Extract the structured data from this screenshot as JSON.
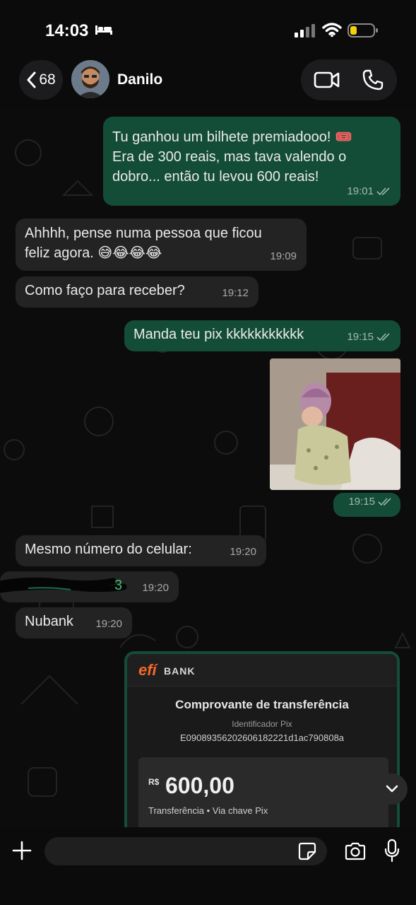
{
  "status_bar": {
    "time": "14:03"
  },
  "header": {
    "back_count": "68",
    "contact_name": "Danilo"
  },
  "messages": [
    {
      "direction": "out",
      "text_lines": [
        "Tu ganhou um bilhete premiadooo! 🎟️",
        "Era de 300 reais, mas tava valendo o",
        "dobro... então tu levou 600 reais!"
      ],
      "time": "19:01"
    },
    {
      "direction": "in",
      "text_lines": [
        "Ahhhh, pense numa pessoa que ficou",
        "feliz agora. 😅😂😂😂"
      ],
      "time": "19:09"
    },
    {
      "direction": "in",
      "text": "Como faço para receber?",
      "time": "19:12"
    },
    {
      "direction": "out",
      "text": "Manda teu pix kkkkkkkkkkk",
      "time": "19:15"
    },
    {
      "direction": "out",
      "type": "image",
      "time": "19:15"
    },
    {
      "direction": "in",
      "text": "Mesmo número do celular:",
      "time": "19:20"
    },
    {
      "direction": "in",
      "text": "3",
      "time": "19:20",
      "redacted": true
    },
    {
      "direction": "in",
      "text": "Nubank",
      "time": "19:20"
    }
  ],
  "receipt": {
    "brand": "efí",
    "bank_word": "BANK",
    "title": "Comprovante de transferência",
    "id_label": "Identificador Pix",
    "id_value": "E09089356202606182221d1ac790808a",
    "currency": "R$",
    "amount": "600,00",
    "transfer_type": "Transferência • Via chave Pix"
  },
  "composer": {
    "placeholder": ""
  },
  "colors": {
    "outgoing_bubble": "#144d37",
    "incoming_bubble": "#232323",
    "background": "#0b0b0b",
    "efi_orange": "#f26a2a"
  }
}
